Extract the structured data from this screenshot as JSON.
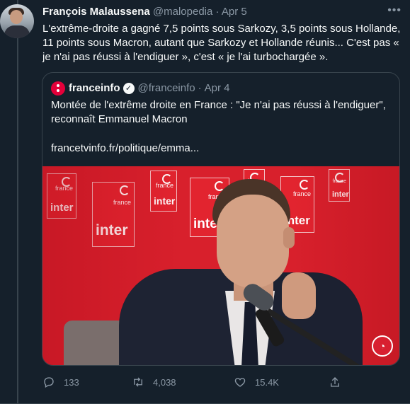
{
  "tweet": {
    "author_name": "François Malaussena",
    "author_handle": "@malopedia",
    "separator": "·",
    "date": "Apr 5",
    "more_icon": "ellipsis-icon",
    "text": "L'extrême-droite a gagné 7,5 points sous Sarkozy, 3,5 points sous Hollande, 11 points sous Macron, autant que Sarkozy et Hollande réunis... C'est pas « je n'ai pas réussi à l'endiguer », c'est « je l'ai turbochargée »."
  },
  "quote": {
    "author_name": "franceinfo",
    "author_handle": "@franceinfo",
    "separator": "·",
    "date": "Apr 4",
    "verified_icon": "verified-badge-icon",
    "text": "Montée de l'extrême droite en France : \"Je n'ai pas réussi à l'endiguer\", reconnaît Emmanuel Macron",
    "link": "francetvinfo.fr/politique/emma...",
    "media": {
      "signs": [
        {
          "small": "france",
          "big": "inter"
        },
        {
          "small": "france",
          "big": "inter"
        },
        {
          "small": "france",
          "big": "inter"
        },
        {
          "small": "france",
          "big": "inter"
        },
        {
          "small": "france",
          "big": "inter"
        },
        {
          "small": "france",
          "big": "inter"
        },
        {
          "small": "france",
          "big": "inter"
        }
      ]
    }
  },
  "actions": {
    "replies": "133",
    "retweets": "4,038",
    "likes": "15.4K",
    "reply_icon": "reply-icon",
    "retweet_icon": "retweet-icon",
    "like_icon": "heart-icon",
    "share_icon": "share-icon"
  },
  "colors": {
    "background": "#15202b",
    "text": "#f7f9f9",
    "muted": "#8b98a5",
    "border": "#38444d",
    "franceinfo_red": "#e4003a"
  }
}
